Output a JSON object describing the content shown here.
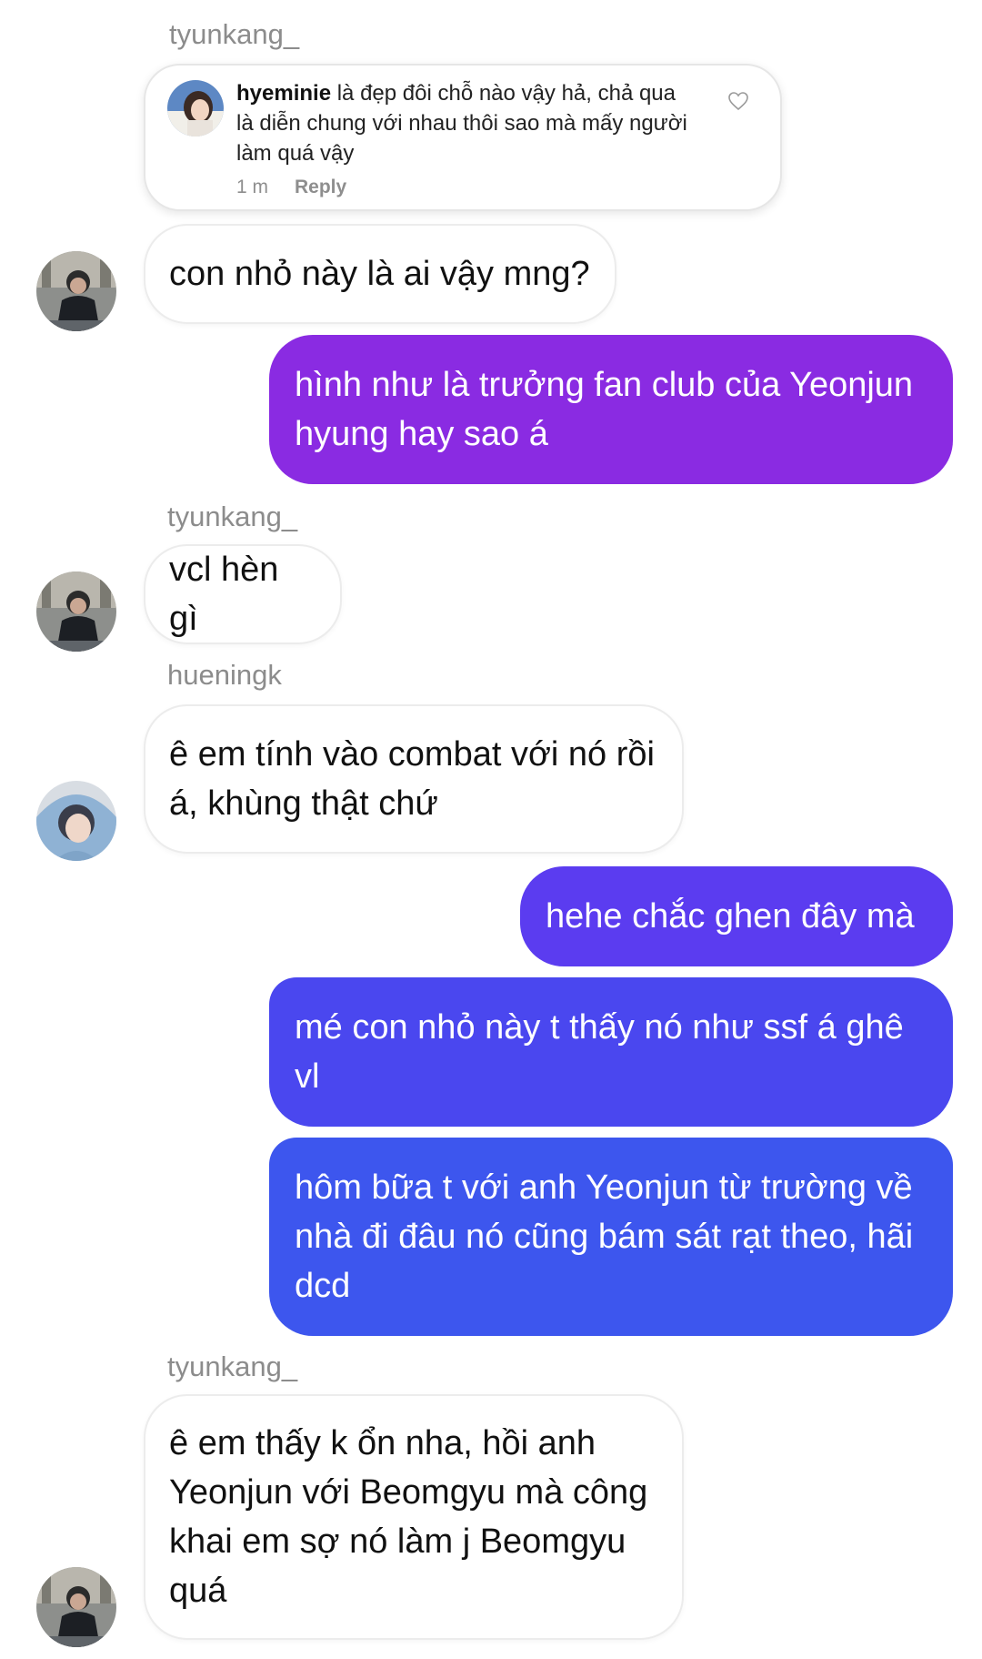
{
  "top_sender": "tyunkang_",
  "replied_comment": {
    "username": "hyeminie",
    "text": "là đẹp đôi chỗ nào vậy hả, chả qua là diễn chung với nhau thôi sao mà mấy người làm quá vậy",
    "time": "1 m",
    "reply_label": "Reply",
    "like_icon": "heart-outline-icon"
  },
  "messages": [
    {
      "from": "tyunkang_",
      "text": "con nhỏ này là ai vậy mng?"
    },
    {
      "from": "me",
      "text": "hình như là trưởng fan club của Yeonjun hyung hay sao á"
    },
    {
      "sender_label": "tyunkang_",
      "from": "tyunkang_",
      "text": "vcl hèn gì"
    },
    {
      "sender_label": "hueningk",
      "from": "hueningk",
      "text": "ê em tính vào combat với nó rồi á, khùng thật chứ"
    },
    {
      "from": "me",
      "text": "hehe chắc ghen đây mà"
    },
    {
      "from": "me",
      "text": "mé con nhỏ này t thấy nó như ssf á ghê vl"
    },
    {
      "from": "me",
      "text": "hôm bữa t với anh Yeonjun từ trường về nhà đi đâu nó cũng bám sát rạt theo, hãi dcd"
    },
    {
      "sender_label": "tyunkang_",
      "from": "tyunkang_",
      "text": "ê em thấy k ổn nha, hồi anh Yeonjun với Beomgyu mà công khai em sợ nó làm j Beomgyu quá"
    }
  ],
  "colors": {
    "outgoing_1": "#8a2be2",
    "outgoing_2": "#5b3cf0",
    "outgoing_3": "#3d56ee",
    "sender_gray": "#8c8c8c"
  }
}
